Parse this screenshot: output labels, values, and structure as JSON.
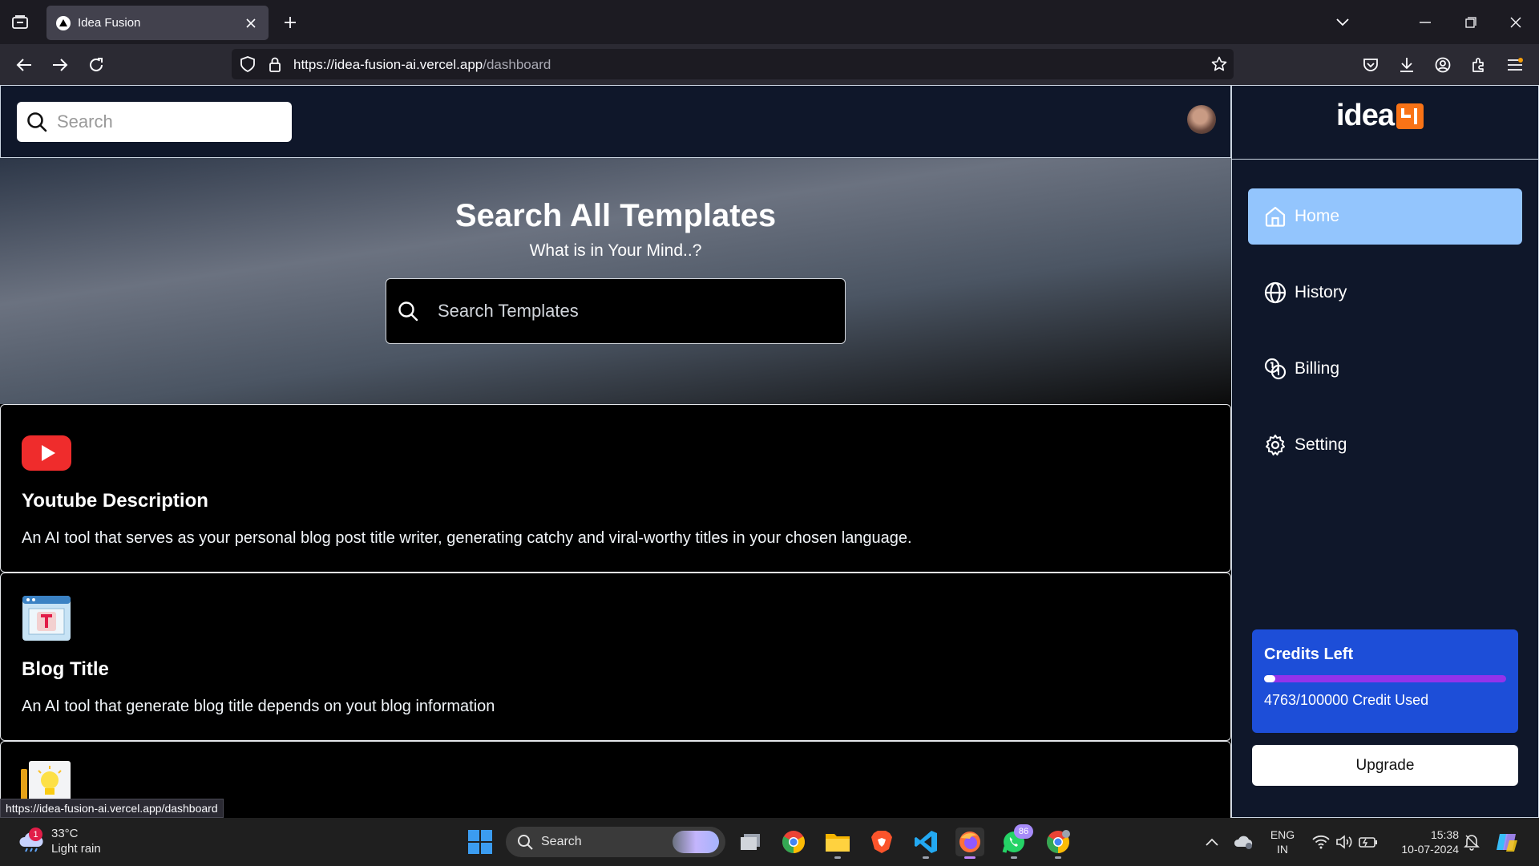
{
  "browser": {
    "tab_title": "Idea Fusion",
    "url_host": "https://idea-fusion-ai.vercel.app",
    "url_path": "/dashboard",
    "status_url": "https://idea-fusion-ai.vercel.app/dashboard"
  },
  "header": {
    "search_placeholder": "Search"
  },
  "hero": {
    "title": "Search All Templates",
    "subtitle": "What is in Your Mind..?",
    "search_placeholder": "Search Templates"
  },
  "templates": [
    {
      "title": "Youtube Description",
      "description": "An AI tool that serves as your personal blog post title writer, generating catchy and viral-worthy titles in your chosen language.",
      "icon": "youtube-icon"
    },
    {
      "title": "Blog Title",
      "description": "An AI tool that generate blog title depends on yout blog information",
      "icon": "blog-title-icon"
    },
    {
      "title": "",
      "description": "",
      "icon": "lightbulb-icon"
    }
  ],
  "sidebar": {
    "logo_text": "idea",
    "items": [
      {
        "label": "Home",
        "icon": "home-icon",
        "active": true
      },
      {
        "label": "History",
        "icon": "globe-icon",
        "active": false
      },
      {
        "label": "Billing",
        "icon": "coins-icon",
        "active": false
      },
      {
        "label": "Setting",
        "icon": "gear-icon",
        "active": false
      }
    ],
    "credits": {
      "title": "Credits Left",
      "used": 4763,
      "total": 100000,
      "text": "4763/100000 Credit Used"
    },
    "upgrade_label": "Upgrade"
  },
  "taskbar": {
    "weather_temp": "33°C",
    "weather_desc": "Light rain",
    "weather_badge": "1",
    "search_label": "Search",
    "whatsapp_badge": "86",
    "lang_top": "ENG",
    "lang_bottom": "IN",
    "time": "15:38",
    "date": "10-07-2024"
  },
  "colors": {
    "accent_active": "#93c5fd",
    "credits_bg": "#1d4ed8",
    "progress": "#9333ea",
    "app_bg": "#0f172a"
  }
}
